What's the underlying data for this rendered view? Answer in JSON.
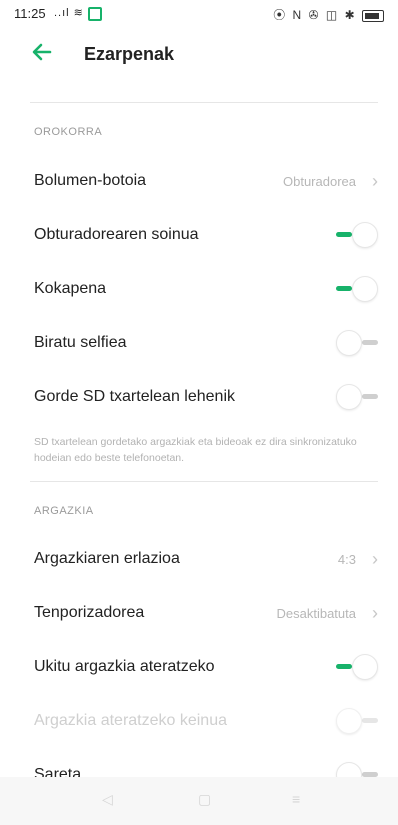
{
  "status_bar": {
    "time": "11:25",
    "left_icons": "..ıl ≋",
    "right_icons": "⦿ N ✇ ◫ ✱",
    "notification_color": "#17b26a"
  },
  "header": {
    "back_icon": "arrow-left",
    "title": "Ezarpenak",
    "accent_color": "#17b26a"
  },
  "sections": {
    "general": {
      "label": "OROKORRA",
      "items": {
        "volume_button": {
          "label": "Bolumen-botoia",
          "value": "Obturadorea"
        },
        "shutter_sound": {
          "label": "Obturadorearen soinua",
          "toggle": true
        },
        "location": {
          "label": "Kokapena",
          "toggle": true
        },
        "mirror_selfie": {
          "label": "Biratu selfiea",
          "toggle": false
        },
        "save_sd": {
          "label": "Gorde SD txartelean lehenik",
          "toggle": false
        }
      },
      "note": "SD txartelean gordetako argazkiak eta bideoak ez dira sinkronizatuko hodeian edo beste telefonoetan."
    },
    "photo": {
      "label": "ARGAZKIA",
      "items": {
        "ratio": {
          "label": "Argazkiaren erlazioa",
          "value": "4:3"
        },
        "timer": {
          "label": "Tenporizadorea",
          "value": "Desaktibatuta"
        },
        "tap_capture": {
          "label": "Ukitu argazkia ateratzeko",
          "toggle": true
        },
        "gesture": {
          "label": "Argazkia ateratzeko keinua",
          "toggle": false,
          "disabled": true
        },
        "grid": {
          "label": "Sareta",
          "toggle": false
        }
      }
    }
  },
  "nav": {
    "back": "◁",
    "home": "▢",
    "recents": "≡"
  }
}
